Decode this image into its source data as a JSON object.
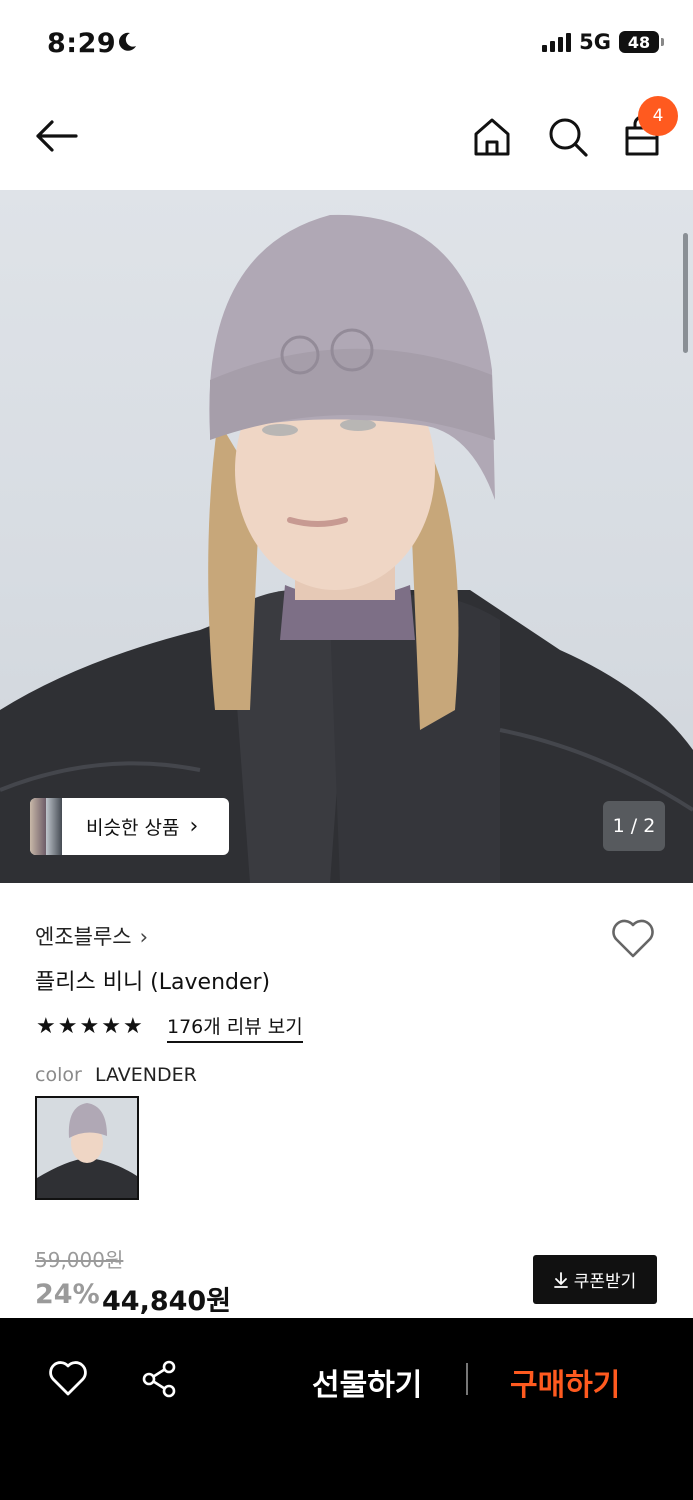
{
  "status": {
    "time": "8:29",
    "network": "5G",
    "battery": "48"
  },
  "header": {
    "cart_count": "4"
  },
  "gallery": {
    "page_indicator": "1 / 2",
    "similar_label": "비슷한 상품"
  },
  "product": {
    "brand": "엔조블루스",
    "name": "플리스 비니 (Lavender)",
    "rating_stars": 5,
    "review_link": "176개 리뷰 보기",
    "color_label": "color",
    "color_value": "LAVENDER",
    "original_price": "59,000원",
    "discount": "24%",
    "sale_price": "44,840원",
    "coupon_label": "쿠폰받기"
  },
  "bottom_bar": {
    "gift_label": "선물하기",
    "buy_label": "구매하기"
  },
  "colors": {
    "accent": "#ff5a1f",
    "dark": "#111111",
    "muted": "#9a9a9a"
  }
}
